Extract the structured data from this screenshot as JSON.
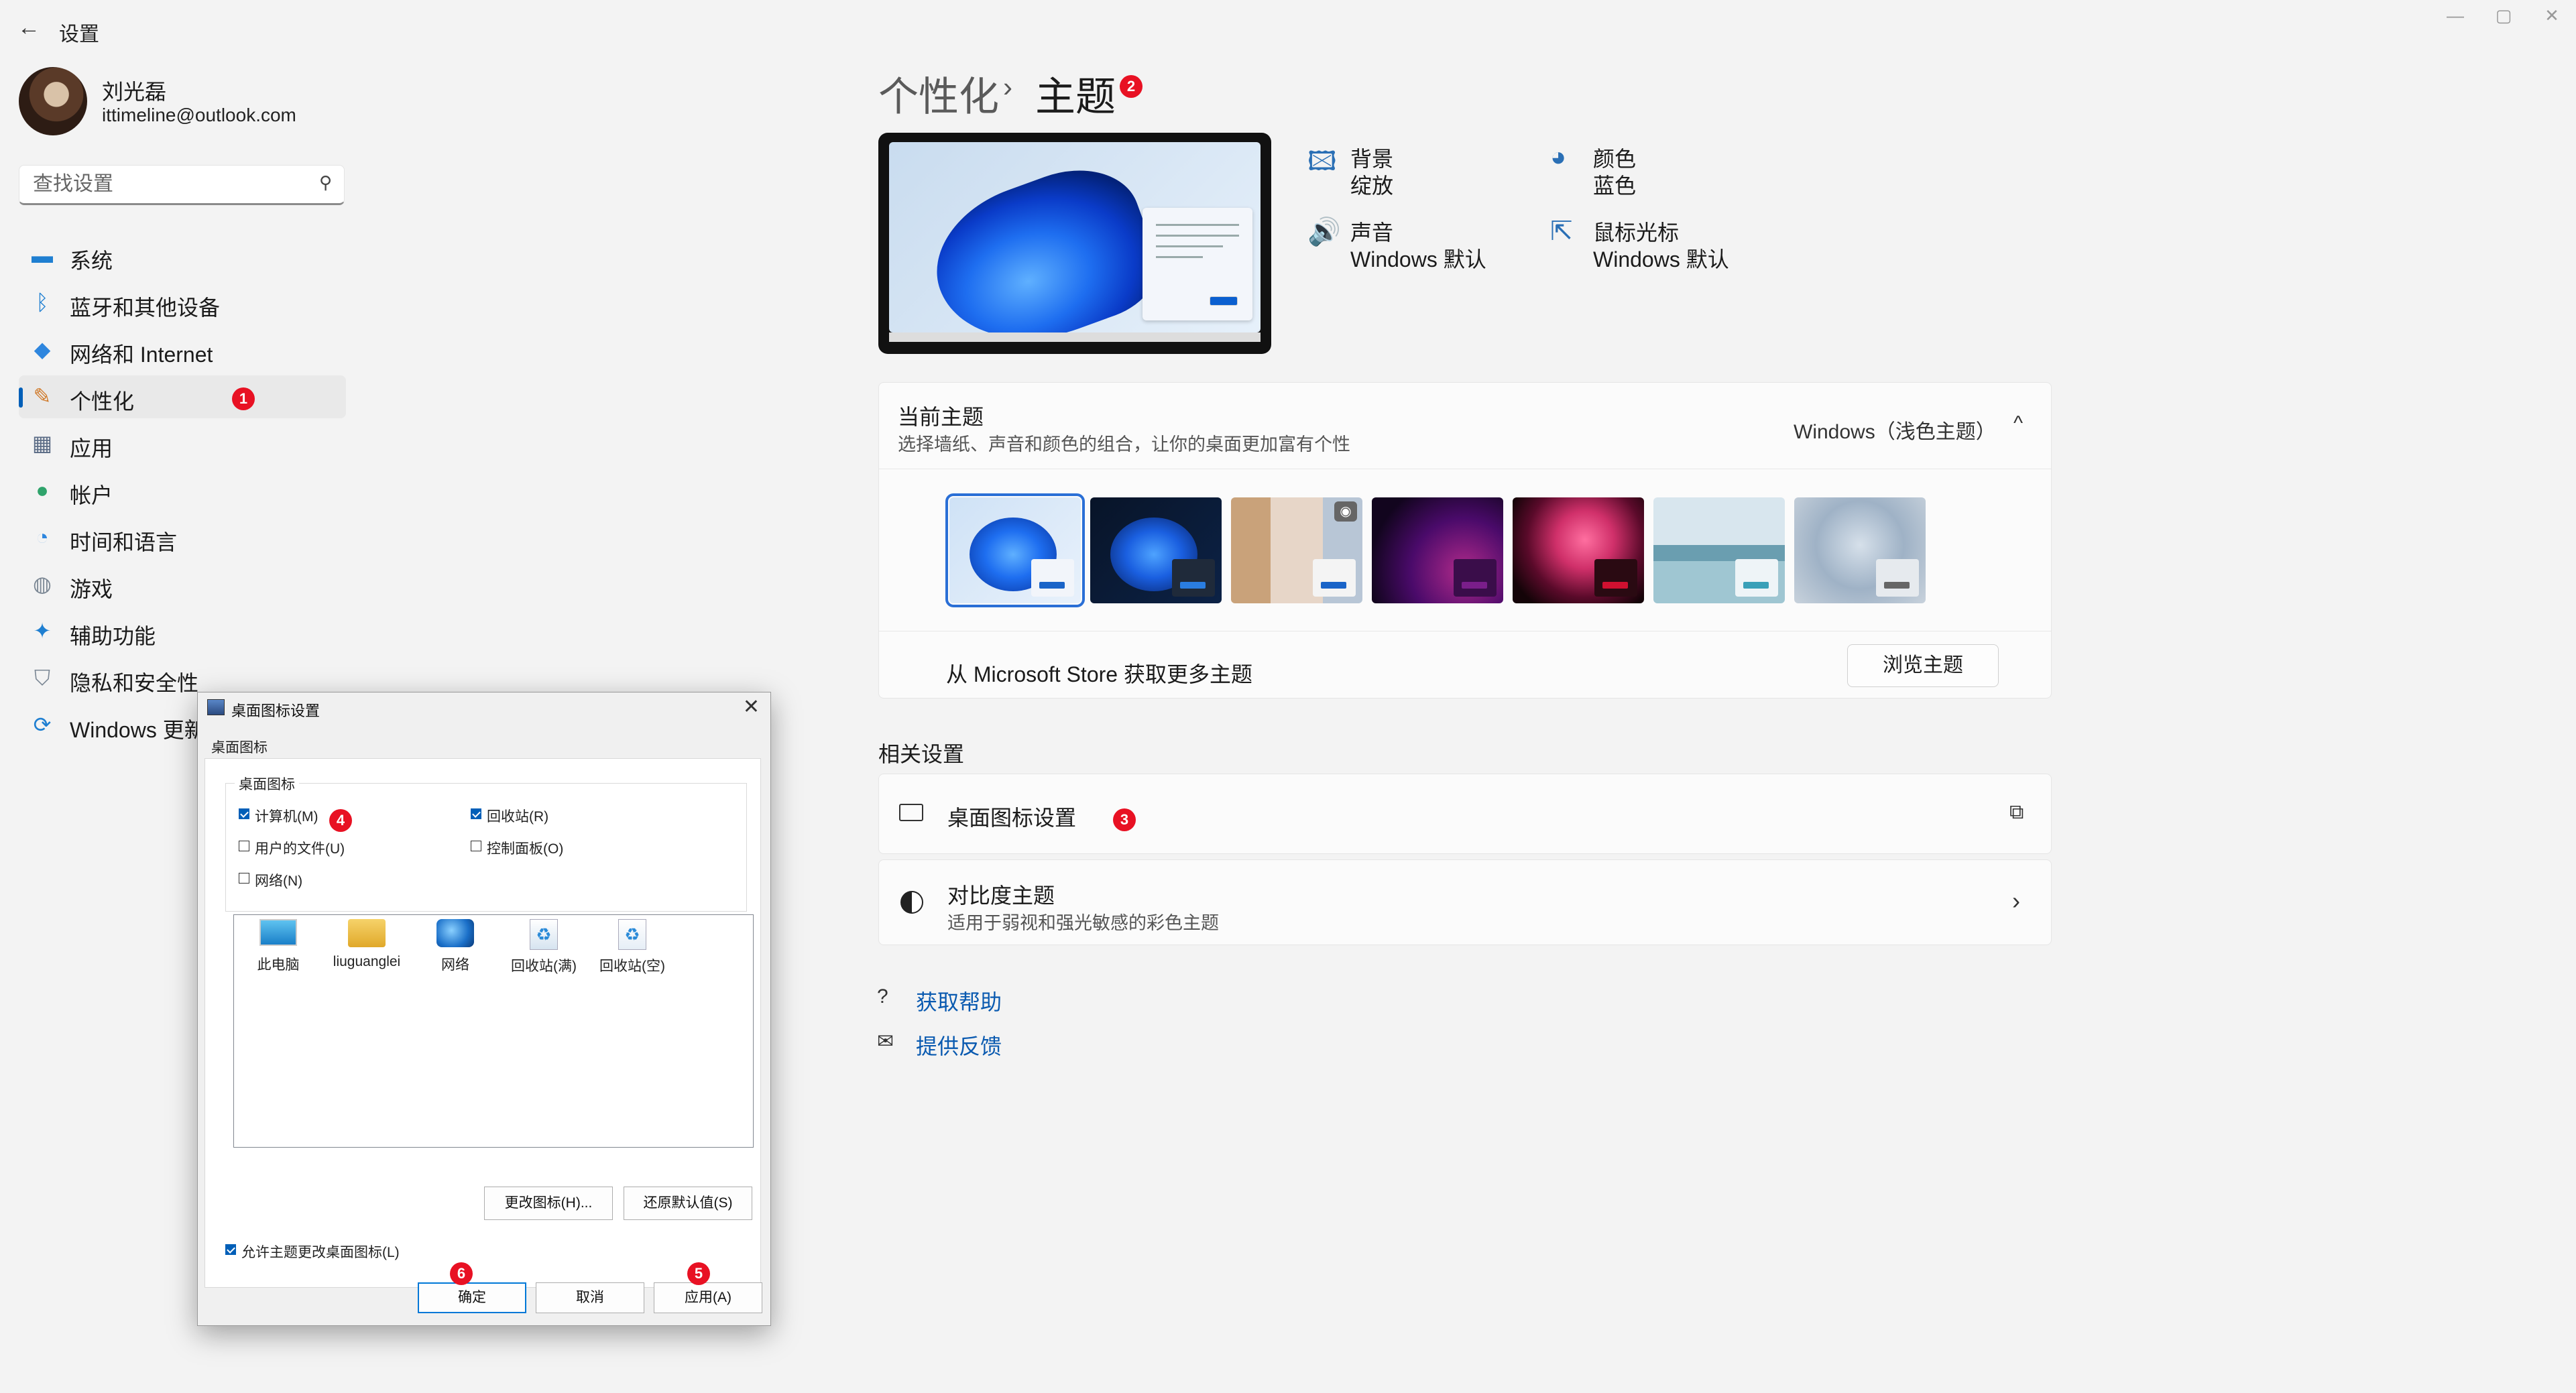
{
  "window": {
    "title": "设置",
    "back": "←",
    "controls": [
      "—",
      "▢",
      "✕"
    ]
  },
  "profile": {
    "name": "刘光磊",
    "email": "ittimeline@outlook.com"
  },
  "search": {
    "placeholder": "查找设置",
    "icon": "⚲"
  },
  "nav": {
    "items": [
      {
        "label": "系统",
        "icon": "monitor-icon",
        "glyph": "▬",
        "color": "#1f7fd1"
      },
      {
        "label": "蓝牙和其他设备",
        "icon": "bluetooth-icon",
        "glyph": "ᛒ",
        "color": "#1f7fd1"
      },
      {
        "label": "网络和 Internet",
        "icon": "wifi-icon",
        "glyph": "◆",
        "color": "#2e86de"
      },
      {
        "label": "个性化",
        "icon": "brush-icon",
        "glyph": "✎",
        "color": "#d07a2a"
      },
      {
        "label": "应用",
        "icon": "apps-icon",
        "glyph": "▦",
        "color": "#5a6b85"
      },
      {
        "label": "帐户",
        "icon": "account-icon",
        "glyph": "●",
        "color": "#2fa36b"
      },
      {
        "label": "时间和语言",
        "icon": "globe-clock-icon",
        "glyph": "◔",
        "color": "#2e86de"
      },
      {
        "label": "游戏",
        "icon": "gamepad-icon",
        "glyph": "◍",
        "color": "#7b8794"
      },
      {
        "label": "辅助功能",
        "icon": "accessibility-icon",
        "glyph": "✦",
        "color": "#1f7fd1"
      },
      {
        "label": "隐私和安全性",
        "icon": "shield-icon",
        "glyph": "⛉",
        "color": "#7b8794"
      },
      {
        "label": "Windows 更新",
        "icon": "update-icon",
        "glyph": "⟳",
        "color": "#1f7fd1"
      }
    ],
    "active_index": 3
  },
  "badges": [
    "1",
    "2",
    "3",
    "4",
    "5",
    "6"
  ],
  "header": {
    "parent": "个性化",
    "separator": "›",
    "current": "主题"
  },
  "theme_props": [
    {
      "label": "背景",
      "value": "绽放",
      "icon": "image-icon",
      "glyph": "🖾"
    },
    {
      "label": "颜色",
      "value": "蓝色",
      "icon": "palette-icon",
      "glyph": "◕"
    },
    {
      "label": "声音",
      "value": "Windows 默认",
      "icon": "speaker-icon",
      "glyph": "🔊"
    },
    {
      "label": "鼠标光标",
      "value": "Windows 默认",
      "icon": "cursor-icon",
      "glyph": "⇱"
    }
  ],
  "current_theme": {
    "title": "当前主题",
    "subtitle": "选择墙纸、声音和颜色的组合，让你的桌面更加富有个性",
    "value": "Windows（浅色主题）",
    "chevron": "^",
    "selected_index": 0
  },
  "store": {
    "text": "从 Microsoft Store 获取更多主题",
    "button": "浏览主题"
  },
  "related": {
    "heading": "相关设置",
    "items": [
      {
        "title": "桌面图标设置",
        "subtitle": "",
        "trail": "⧉"
      },
      {
        "title": "对比度主题",
        "subtitle": "适用于弱视和强光敏感的彩色主题",
        "trail": "›"
      }
    ]
  },
  "help_links": [
    {
      "label": "获取帮助",
      "icon": "help-icon",
      "glyph": "?"
    },
    {
      "label": "提供反馈",
      "icon": "feedback-icon",
      "glyph": "✉"
    }
  ],
  "dialog": {
    "title": "桌面图标设置",
    "close": "✕",
    "tab": "桌面图标",
    "group_title": "桌面图标",
    "checkboxes": [
      {
        "label": "计算机(M)",
        "checked": true
      },
      {
        "label": "回收站(R)",
        "checked": true
      },
      {
        "label": "用户的文件(U)",
        "checked": false
      },
      {
        "label": "控制面板(O)",
        "checked": false
      },
      {
        "label": "网络(N)",
        "checked": false
      }
    ],
    "icons": [
      {
        "label": "此电脑",
        "icon": "this-pc-icon"
      },
      {
        "label": "liuguanglei",
        "icon": "user-folder-icon"
      },
      {
        "label": "网络",
        "icon": "network-icon"
      },
      {
        "label": "回收站(满)",
        "icon": "recycle-bin-full-icon"
      },
      {
        "label": "回收站(空)",
        "icon": "recycle-bin-empty-icon"
      }
    ],
    "change_icon_button": "更改图标(H)...",
    "restore_default_button": "还原默认值(S)",
    "allow_themes": {
      "label": "允许主题更改桌面图标(L)",
      "checked": true
    },
    "ok_button": "确定",
    "cancel_button": "取消",
    "apply_button": "应用(A)"
  }
}
